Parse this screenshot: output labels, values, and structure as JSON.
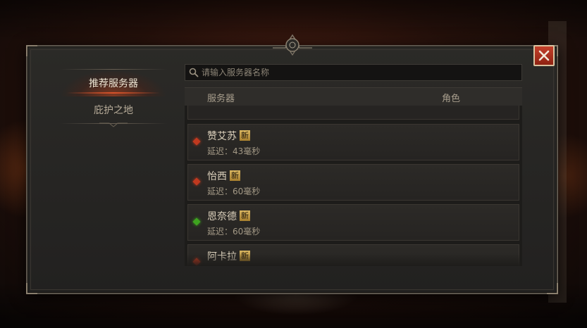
{
  "sidebar": {
    "items": [
      {
        "label": "推荐服务器",
        "active": true
      },
      {
        "label": "庇护之地",
        "active": false
      }
    ]
  },
  "search": {
    "placeholder": "请输入服务器名称",
    "value": ""
  },
  "list_header": {
    "server_label": "服务器",
    "role_label": "角色"
  },
  "servers": [
    {
      "name": "赞艾苏",
      "badge": "新",
      "latency": "延迟：43毫秒",
      "status_color": "#c0391f"
    },
    {
      "name": "怡西",
      "badge": "新",
      "latency": "延迟：60毫秒",
      "status_color": "#c0391f"
    },
    {
      "name": "恩奈德",
      "badge": "新",
      "latency": "延迟：60毫秒",
      "status_color": "#3ea31f"
    },
    {
      "name": "阿卡拉",
      "badge": "新",
      "latency": "",
      "status_color": "#c0391f"
    }
  ],
  "colors": {
    "accent": "#d8532a",
    "close_button": "#b5331f",
    "badge": "#c89f48"
  },
  "icons": {
    "close": "close-icon",
    "search": "search-icon"
  }
}
